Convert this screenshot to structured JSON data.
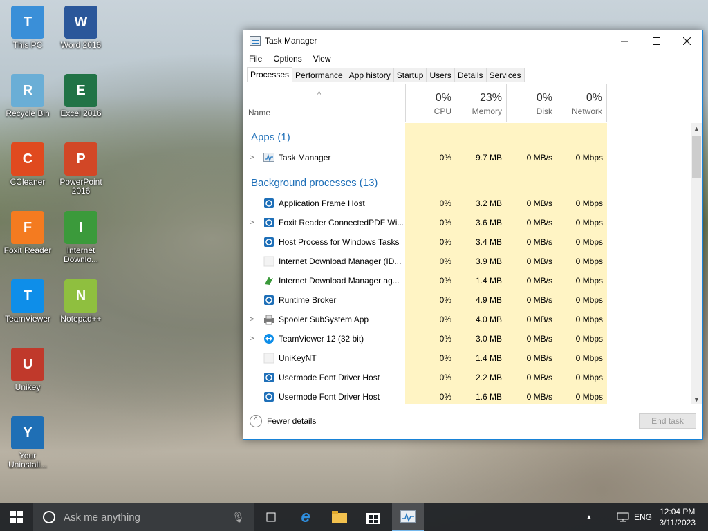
{
  "desktop": {
    "icons": [
      {
        "label": "This PC",
        "icon": "computer-icon",
        "color": "#3a8fd8"
      },
      {
        "label": "Word 2016",
        "icon": "word-icon",
        "color": "#2b579a"
      },
      {
        "label": "Recycle Bin",
        "icon": "recycle-bin-icon",
        "color": "#6aaed6"
      },
      {
        "label": "Excel 2016",
        "icon": "excel-icon",
        "color": "#217346"
      },
      {
        "label": "CCleaner",
        "icon": "ccleaner-icon",
        "color": "#e04a1f"
      },
      {
        "label": "PowerPoint 2016",
        "icon": "powerpoint-icon",
        "color": "#d24726"
      },
      {
        "label": "Foxit Reader",
        "icon": "foxit-icon",
        "color": "#f47b20"
      },
      {
        "label": "Internet Downlo...",
        "icon": "idm-icon",
        "color": "#3b9a3b"
      },
      {
        "label": "TeamViewer",
        "icon": "teamviewer-icon",
        "color": "#0e8ee9"
      },
      {
        "label": "Notepad++",
        "icon": "notepadpp-icon",
        "color": "#8fbf3f"
      },
      {
        "label": "Unikey",
        "icon": "unikey-icon",
        "color": "#c0392b"
      },
      {
        "label": "Your Uninstall...",
        "icon": "uninstaller-icon",
        "color": "#1f6fb5"
      }
    ]
  },
  "window": {
    "title": "Task Manager",
    "menu": [
      "File",
      "Options",
      "View"
    ],
    "tabs": [
      "Processes",
      "Performance",
      "App history",
      "Startup",
      "Users",
      "Details",
      "Services"
    ],
    "active_tab": "Processes"
  },
  "columns": {
    "name": "Name",
    "cpu": {
      "pct": "0%",
      "label": "CPU"
    },
    "memory": {
      "pct": "23%",
      "label": "Memory"
    },
    "disk": {
      "pct": "0%",
      "label": "Disk"
    },
    "network": {
      "pct": "0%",
      "label": "Network"
    }
  },
  "groups": {
    "apps": "Apps (1)",
    "background": "Background processes (13)"
  },
  "apps": [
    {
      "name": "Task Manager",
      "cpu": "0%",
      "memory": "9.7 MB",
      "disk": "0 MB/s",
      "network": "0 Mbps",
      "expand": true,
      "icon": "task-manager-icon"
    }
  ],
  "background": [
    {
      "name": "Application Frame Host",
      "cpu": "0%",
      "memory": "3.2 MB",
      "disk": "0 MB/s",
      "network": "0 Mbps",
      "expand": false,
      "icon": "system-process-icon"
    },
    {
      "name": "Foxit Reader ConnectedPDF Wi...",
      "cpu": "0%",
      "memory": "3.6 MB",
      "disk": "0 MB/s",
      "network": "0 Mbps",
      "expand": true,
      "icon": "system-process-icon"
    },
    {
      "name": "Host Process for Windows Tasks",
      "cpu": "0%",
      "memory": "3.4 MB",
      "disk": "0 MB/s",
      "network": "0 Mbps",
      "expand": false,
      "icon": "system-process-icon"
    },
    {
      "name": "Internet Download Manager (ID...",
      "cpu": "0%",
      "memory": "3.9 MB",
      "disk": "0 MB/s",
      "network": "0 Mbps",
      "expand": false,
      "icon": "blank-process-icon"
    },
    {
      "name": "Internet Download Manager ag...",
      "cpu": "0%",
      "memory": "1.4 MB",
      "disk": "0 MB/s",
      "network": "0 Mbps",
      "expand": false,
      "icon": "idm-process-icon"
    },
    {
      "name": "Runtime Broker",
      "cpu": "0%",
      "memory": "4.9 MB",
      "disk": "0 MB/s",
      "network": "0 Mbps",
      "expand": false,
      "icon": "system-process-icon"
    },
    {
      "name": "Spooler SubSystem App",
      "cpu": "0%",
      "memory": "4.0 MB",
      "disk": "0 MB/s",
      "network": "0 Mbps",
      "expand": true,
      "icon": "printer-icon"
    },
    {
      "name": "TeamViewer 12 (32 bit)",
      "cpu": "0%",
      "memory": "3.0 MB",
      "disk": "0 MB/s",
      "network": "0 Mbps",
      "expand": true,
      "icon": "teamviewer-process-icon"
    },
    {
      "name": "UniKeyNT",
      "cpu": "0%",
      "memory": "1.4 MB",
      "disk": "0 MB/s",
      "network": "0 Mbps",
      "expand": false,
      "icon": "blank-process-icon"
    },
    {
      "name": "Usermode Font Driver Host",
      "cpu": "0%",
      "memory": "2.2 MB",
      "disk": "0 MB/s",
      "network": "0 Mbps",
      "expand": false,
      "icon": "system-process-icon"
    },
    {
      "name": "Usermode Font Driver Host",
      "cpu": "0%",
      "memory": "1.6 MB",
      "disk": "0 MB/s",
      "network": "0 Mbps",
      "expand": false,
      "icon": "system-process-icon"
    }
  ],
  "footer": {
    "fewer_details": "Fewer details",
    "end_task": "End task"
  },
  "taskbar": {
    "search_placeholder": "Ask me anything",
    "language": "ENG",
    "time": "12:04 PM",
    "date": "3/11/2023"
  },
  "colors": {
    "accent": "#1883d7",
    "heat": "#fff4c4",
    "group": "#1e6fb8"
  }
}
